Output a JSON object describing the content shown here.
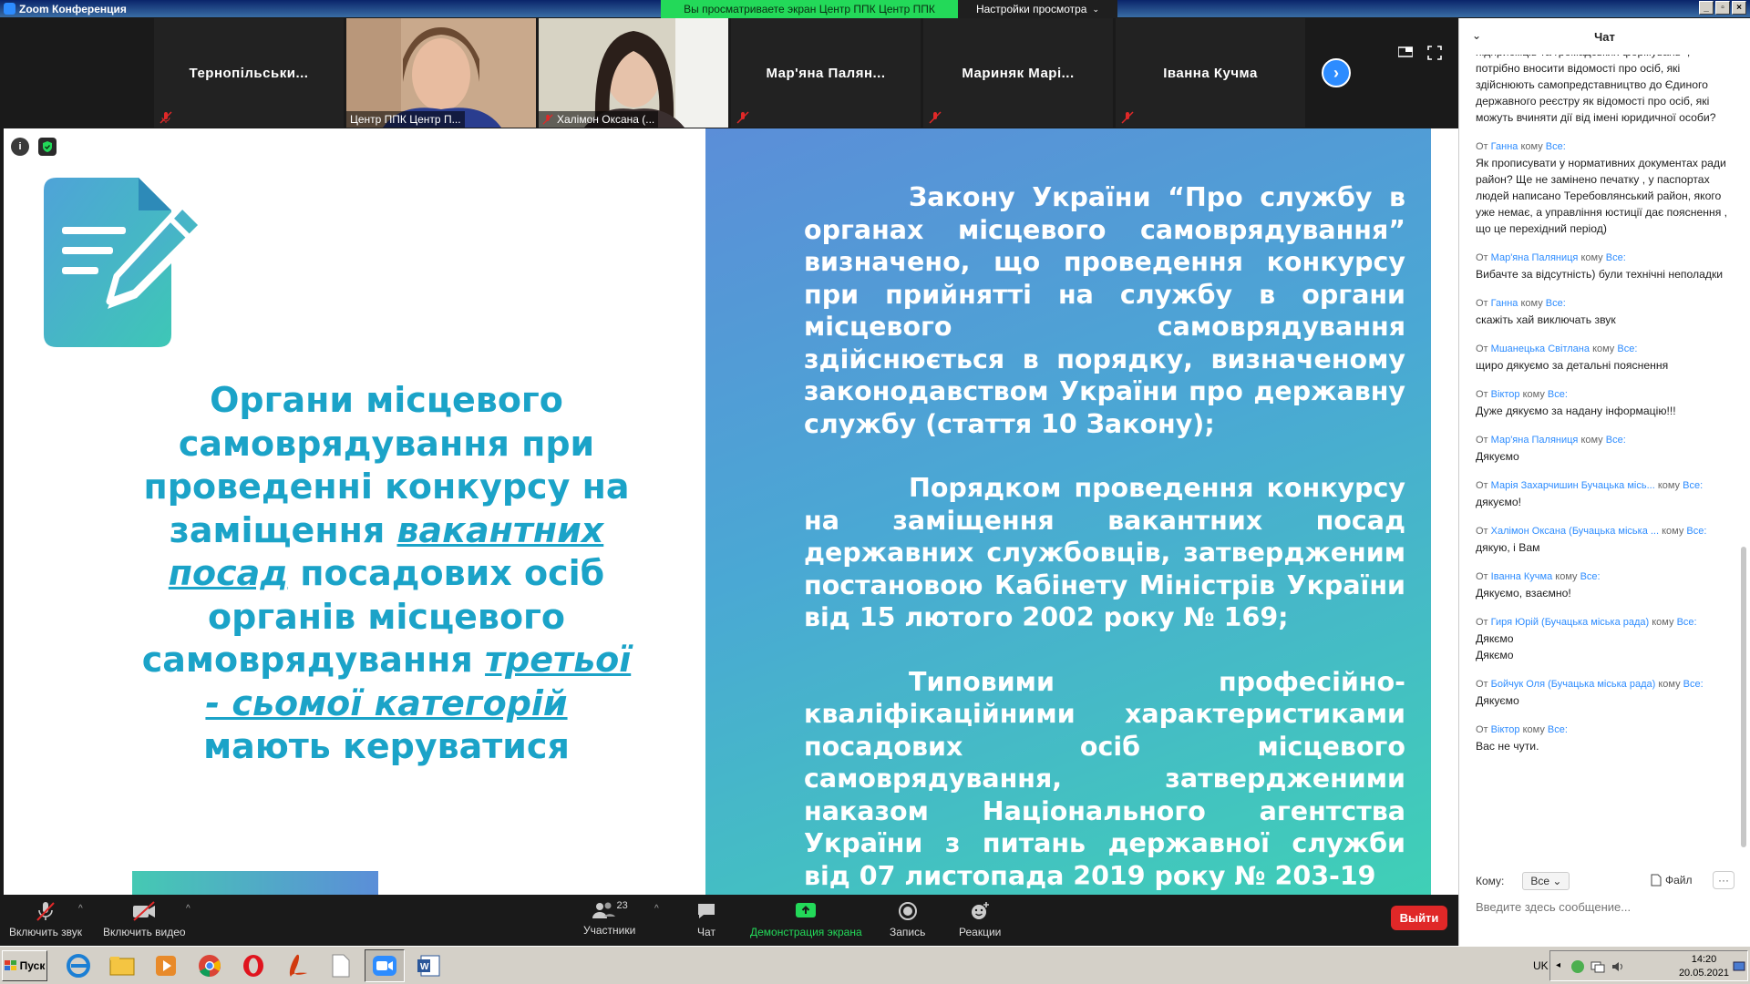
{
  "window": {
    "title": "Zoom Конференция"
  },
  "banner": {
    "viewing": "Вы просматриваете экран Центр ППК Центр ППК",
    "view_options": "Настройки просмотра"
  },
  "participants": [
    {
      "name": "Тернопільськи..."
    },
    {
      "name": "Центр ППК Центр П..."
    },
    {
      "name": "Халімон Оксана (..."
    },
    {
      "name": "Мар'яна  Палян..."
    },
    {
      "name": "Мариняк  Марі..."
    },
    {
      "name": "Іванна Кучма"
    }
  ],
  "slide": {
    "left_lines": {
      "l1": "Органи місцевого",
      "l2": "самоврядування при",
      "l3": "проведенні конкурсу на",
      "l4a": "заміщення ",
      "l4b": "вакантних",
      "l5a": "посад",
      "l5b": " посадових осіб",
      "l6": "органів  місцевого",
      "l7a": "самоврядування  ",
      "l7b": "третьої",
      "l8": "-  сьомої  категорій",
      "l9": "мають керуватися"
    },
    "right_paragraphs": [
      "Закону України “Про службу в органах місцевого самоврядування” визначено, що проведення конкурсу при прийнятті на службу в органи місцевого самоврядування здійснюється в порядку, визначеному законодавством України про державну службу (стаття 10 Закону);",
      "Порядком проведення конкурсу на заміщення вакантних посад державних службовців, затвердженим постановою Кабінету Міністрів України від 15 лютого 2002 року № 169;",
      "Типовими професійно-кваліфікаційними характеристиками посадових осіб місцевого самоврядування, затвердженими наказом Національного агентства України з питань державної служби від 07 листопада 2019 року  № 203-19"
    ]
  },
  "toolbar": {
    "mute": "Включить звук",
    "video": "Включить видео",
    "participants": "Участники",
    "participants_count": "23",
    "chat": "Чат",
    "share": "Демонстрация экрана",
    "record": "Запись",
    "reactions": "Реакции",
    "leave": "Выйти"
  },
  "chat": {
    "title": "Чат",
    "messages": [
      {
        "from": "",
        "to": "",
        "text": "підприємців та громадських формувань», потрібно вносити відомості про осіб, які здійснюють самопредставництво до Єдиного державного реєстру як відомості про осіб, які можуть вчиняти дії від імені юридичної особи?"
      },
      {
        "from": "Ганна",
        "to": "Все:",
        "text": "Як прописувати у нормативних документах ради   район? Ще не замінено печатку ,   у паспортах людей написано Теребовлянський район, якого уже немає, а управління юстиції дає пояснення , що це  перехідний період)"
      },
      {
        "from": "Мар'яна Паляниця",
        "to": "Все:",
        "text": "Вибачте за відсутність) були технічні неполадки"
      },
      {
        "from": "Ганна",
        "to": "Все:",
        "text": "скажіть хай виключать звук"
      },
      {
        "from": "Мшанецька Світлана",
        "to": "Все:",
        "text": "щиро дякуємо за детальні пояснення"
      },
      {
        "from": "Віктор",
        "to": "Все:",
        "text": "Дуже дякуємо за надану інформацію!!!"
      },
      {
        "from": "Мар'яна Паляниця",
        "to": "Все:",
        "text": "Дякуємо"
      },
      {
        "from": "Марія Захарчишин Бучацька місь...",
        "to": "Все:",
        "text": "дякуємо!"
      },
      {
        "from": "Халімон Оксана (Бучацька міська ...",
        "to": "Все:",
        "text": "дякую, і Вам"
      },
      {
        "from": "Іванна Кучма",
        "to": "Все:",
        "text": "Дякуємо, взаємно!"
      },
      {
        "from": "Гиря Юрій (Бучацька міська рада)",
        "to": "Все:",
        "text": "Дякємо\nДякємо"
      },
      {
        "from": "Бойчук Оля (Бучацька міська рада)",
        "to": "Все:",
        "text": "Дякуємо"
      },
      {
        "from": "Віктор",
        "to": "Все:",
        "text": "Вас не чути."
      }
    ],
    "from_prefix": "От",
    "to_word": "кому",
    "to_label": "Кому:",
    "to_value": "Все",
    "file_label": "Файл",
    "input_placeholder": "Введите здесь сообщение..."
  },
  "taskbar": {
    "start": "Пуск",
    "lang": "UK",
    "time": "14:20",
    "date": "20.05.2021"
  },
  "colors": {
    "zoom_blue": "#2d8cff",
    "banner_green": "#23d959",
    "leave_red": "#e02828",
    "slide_text": "#1ba3c8"
  }
}
